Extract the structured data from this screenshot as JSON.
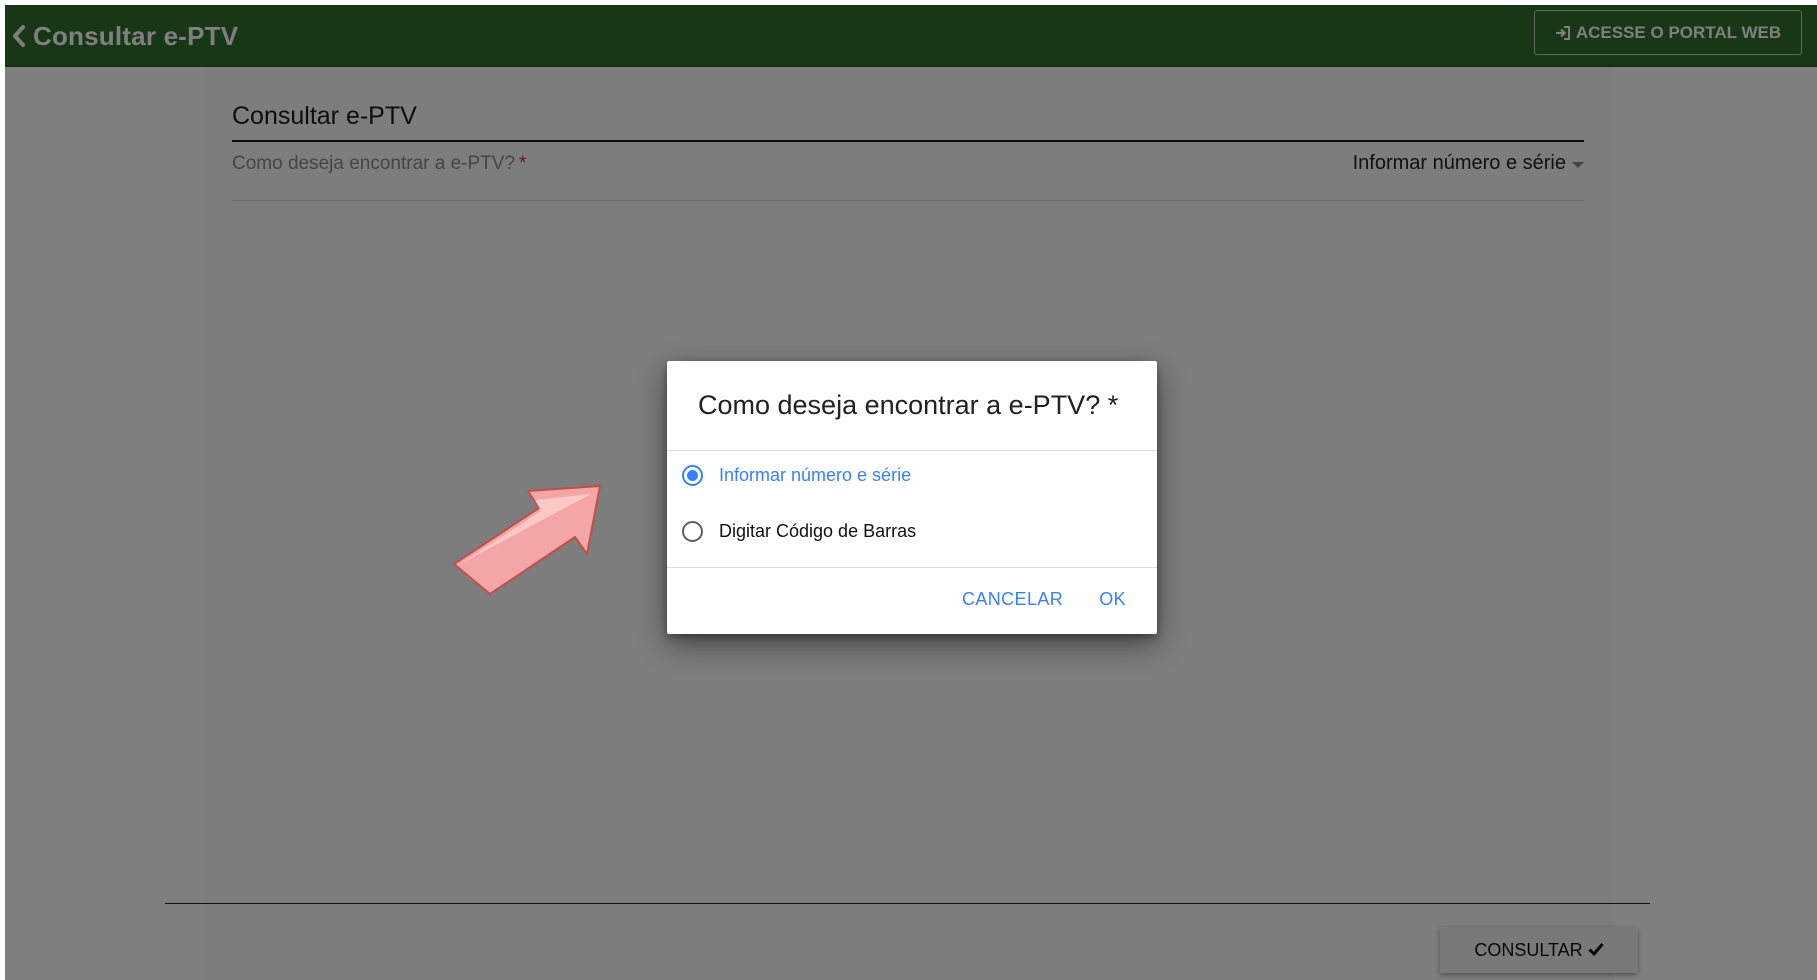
{
  "header": {
    "back_icon": "chevron-left-icon",
    "title": "Consultar e-PTV",
    "portal_button": {
      "icon": "sign-in-icon",
      "label": "ACESSE O PORTAL WEB"
    },
    "color": "#2f6e2c"
  },
  "form": {
    "title": "Consultar e-PTV",
    "field": {
      "label": "Como deseja encontrar a e-PTV?",
      "required_mark": "*",
      "value": "Informar número e série"
    },
    "submit": {
      "label": "CONSULTAR",
      "icon": "checkmark-icon"
    }
  },
  "dialog": {
    "title": "Como deseja encontrar a e-PTV? *",
    "options": [
      {
        "label": "Informar número e série",
        "selected": true
      },
      {
        "label": "Digitar Código de Barras",
        "selected": false
      }
    ],
    "cancel_label": "CANCELAR",
    "ok_label": "OK",
    "accent_color": "#3880ff"
  },
  "annotation": {
    "arrow_icon": "pointer-arrow-icon",
    "arrow_color": "#f4a5a5"
  }
}
